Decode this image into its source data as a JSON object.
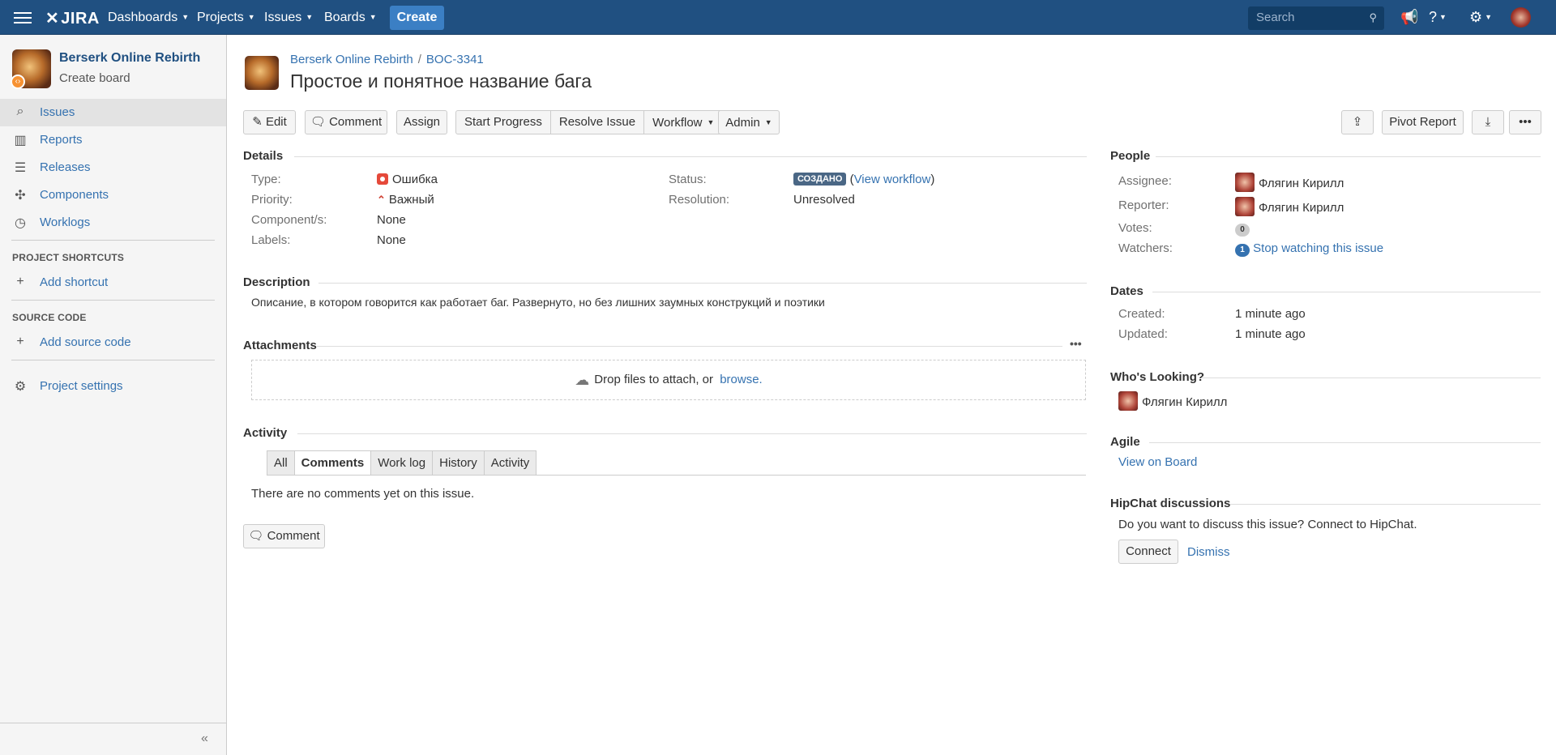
{
  "topnav": {
    "logo": "JIRA",
    "menus": [
      "Dashboards",
      "Projects",
      "Issues",
      "Boards"
    ],
    "create_label": "Create",
    "search_placeholder": "Search"
  },
  "sidebar": {
    "project_name": "Berserk Online Rebirth",
    "project_sub": "Create board",
    "items": [
      {
        "label": "Issues",
        "icon": "issues-icon"
      },
      {
        "label": "Reports",
        "icon": "reports-icon"
      },
      {
        "label": "Releases",
        "icon": "releases-icon"
      },
      {
        "label": "Components",
        "icon": "components-icon"
      },
      {
        "label": "Worklogs",
        "icon": "worklogs-icon"
      }
    ],
    "shortcuts_heading": "PROJECT SHORTCUTS",
    "add_shortcut": "Add shortcut",
    "source_heading": "SOURCE CODE",
    "add_source": "Add source code",
    "settings": "Project settings"
  },
  "issue": {
    "project": "Berserk Online Rebirth",
    "key": "BOC-3341",
    "title": "Простое и понятное название бага"
  },
  "toolbar": {
    "edit": "Edit",
    "comment": "Comment",
    "assign": "Assign",
    "start_progress": "Start Progress",
    "resolve": "Resolve Issue",
    "workflow": "Workflow",
    "admin": "Admin",
    "pivot": "Pivot Report"
  },
  "details": {
    "heading": "Details",
    "type_label": "Type:",
    "type_value": "Ошибка",
    "priority_label": "Priority:",
    "priority_value": "Важный",
    "components_label": "Component/s:",
    "components_value": "None",
    "labels_label": "Labels:",
    "labels_value": "None",
    "status_label": "Status:",
    "status_value": "СОЗДАНО",
    "view_workflow": "View workflow",
    "resolution_label": "Resolution:",
    "resolution_value": "Unresolved"
  },
  "description": {
    "heading": "Description",
    "text": "Описание, в котором говорится как работает баг. Развернуто, но без лишних заумных конструкций и поэтики"
  },
  "attachments": {
    "heading": "Attachments",
    "drop_text": "Drop files to attach, or",
    "browse": "browse."
  },
  "activity": {
    "heading": "Activity",
    "tabs": [
      "All",
      "Comments",
      "Work log",
      "History",
      "Activity"
    ],
    "empty": "There are no comments yet on this issue.",
    "comment_button": "Comment"
  },
  "people": {
    "heading": "People",
    "assignee_label": "Assignee:",
    "assignee": "Флягин Кирилл",
    "reporter_label": "Reporter:",
    "reporter": "Флягин Кирилл",
    "votes_label": "Votes:",
    "votes": "0",
    "watchers_label": "Watchers:",
    "watchers": "1",
    "stop_watching": "Stop watching this issue"
  },
  "dates": {
    "heading": "Dates",
    "created_label": "Created:",
    "created": "1 minute ago",
    "updated_label": "Updated:",
    "updated": "1 minute ago"
  },
  "whos_looking": {
    "heading": "Who's Looking?",
    "user": "Флягин Кирилл"
  },
  "agile": {
    "heading": "Agile",
    "link": "View on Board"
  },
  "hipchat": {
    "heading": "HipChat discussions",
    "text": "Do you want to discuss this issue? Connect to HipChat.",
    "connect": "Connect",
    "dismiss": "Dismiss"
  }
}
